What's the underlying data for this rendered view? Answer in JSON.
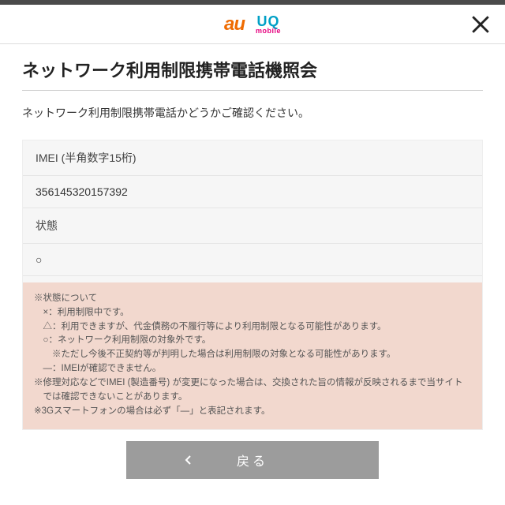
{
  "header": {
    "au": "au",
    "uq_top": "UQ",
    "uq_bot": "mobile"
  },
  "title": "ネットワーク利用制限携帯電話機照会",
  "lead": "ネットワーク利用制限携帯電話かどうかご確認ください。",
  "card": {
    "imei_label": "IMEI (半角数字15桁)",
    "imei_value": "356145320157392",
    "status_label": "状態",
    "status_value": "○"
  },
  "notice": {
    "head": "※状態について",
    "x": "×：利用制限中です。",
    "tri": "△：利用できますが、代金債務の不履行等により利用制限となる可能性があります。",
    "circ": "○：ネットワーク利用制限の対象外です。",
    "circ_note": "※ただし今後不正契約等が判明した場合は利用制限の対象となる可能性があります。",
    "dash": "―：IMEIが確認できません。",
    "repair": "※修理対応などでIMEI (製造番号) が変更になった場合は、交換された旨の情報が反映されるまで当サイトでは確認できないことがあります。",
    "threeg": "※3Gスマートフォンの場合は必ず「―」と表記されます。"
  },
  "back_label": "戻る"
}
